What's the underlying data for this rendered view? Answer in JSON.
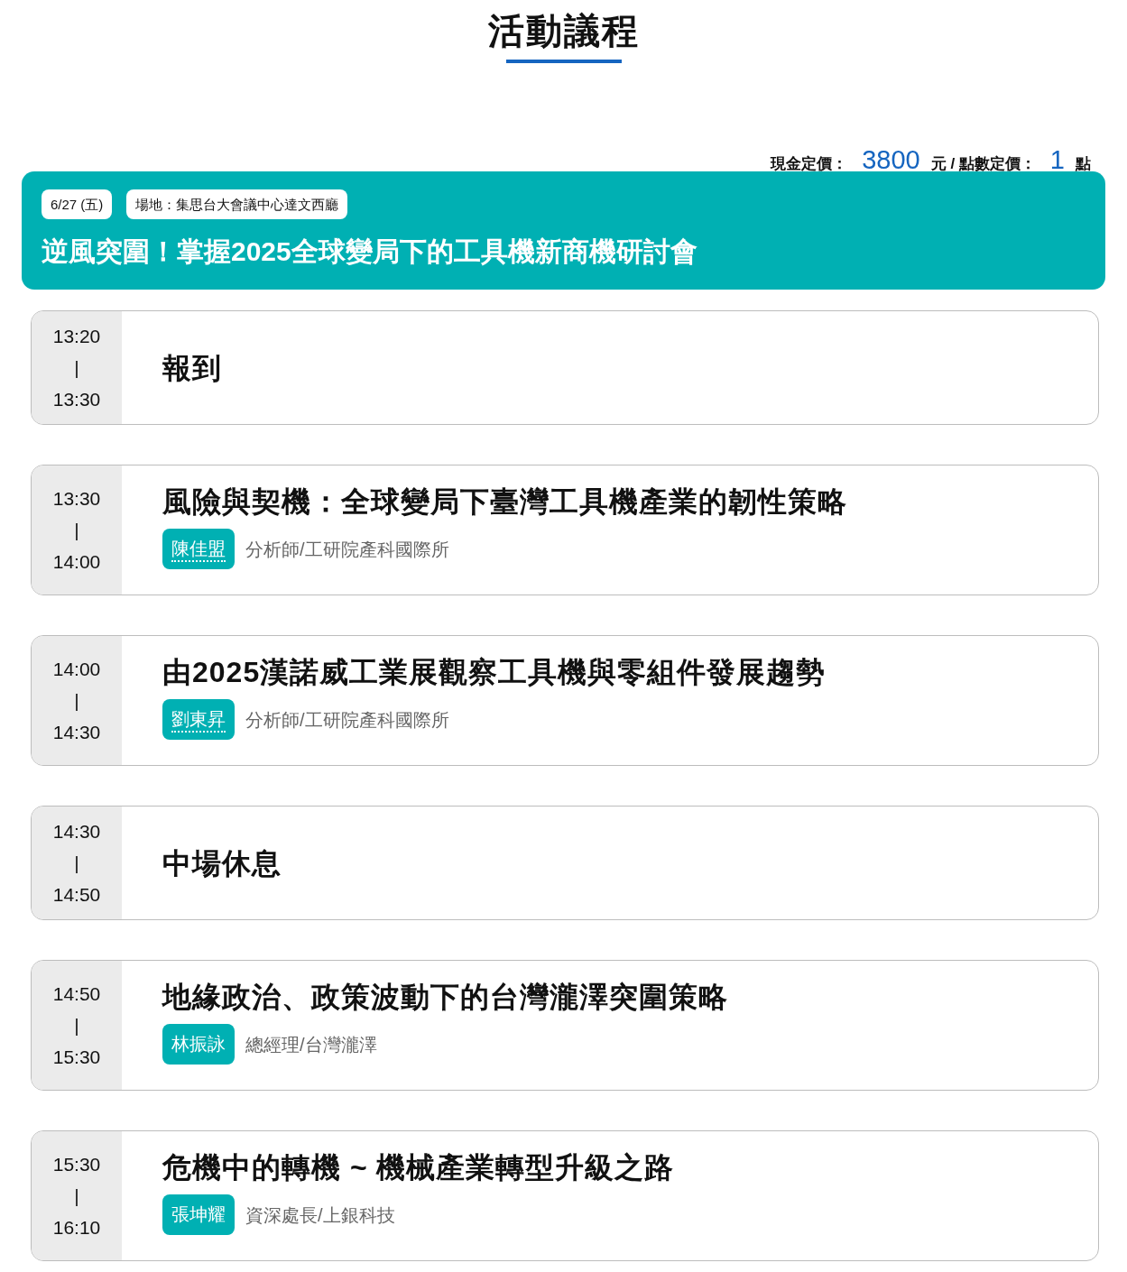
{
  "heading": "活動議程",
  "pricing": {
    "cash_label": "現金定價：",
    "cash_value": "3800",
    "cash_unit": "元 / 點數定價：",
    "points_value": "1",
    "points_unit": "點"
  },
  "event": {
    "date": "6/27 (五)",
    "venue": "場地：集思台大會議中心達文西廳",
    "title": "逆風突圍！掌握2025全球變局下的工具機新商機研討會"
  },
  "sessions": [
    {
      "start": "13:20",
      "separator": "|",
      "end": "13:30",
      "title": "報到"
    },
    {
      "start": "13:30",
      "separator": "|",
      "end": "14:00",
      "title": "風險與契機：全球變局下臺灣工具機產業的韌性策略",
      "speaker": {
        "name": "陳佳盟",
        "linked": true,
        "role": "分析師/工研院產科國際所"
      }
    },
    {
      "start": "14:00",
      "separator": "|",
      "end": "14:30",
      "title": "由2025漢諾威工業展觀察工具機與零組件發展趨勢",
      "speaker": {
        "name": "劉東昇",
        "linked": true,
        "role": "分析師/工研院產科國際所"
      }
    },
    {
      "start": "14:30",
      "separator": "|",
      "end": "14:50",
      "title": "中場休息"
    },
    {
      "start": "14:50",
      "separator": "|",
      "end": "15:30",
      "title": "地緣政治、政策波動下的台灣瀧澤突圍策略",
      "speaker": {
        "name": "林振詠",
        "linked": false,
        "role": "總經理/台灣瀧澤"
      }
    },
    {
      "start": "15:30",
      "separator": "|",
      "end": "16:10",
      "title": "危機中的轉機 ~ 機械產業轉型升級之路",
      "speaker": {
        "name": "張坤耀",
        "linked": false,
        "role": "資深處長/上銀科技"
      }
    }
  ]
}
